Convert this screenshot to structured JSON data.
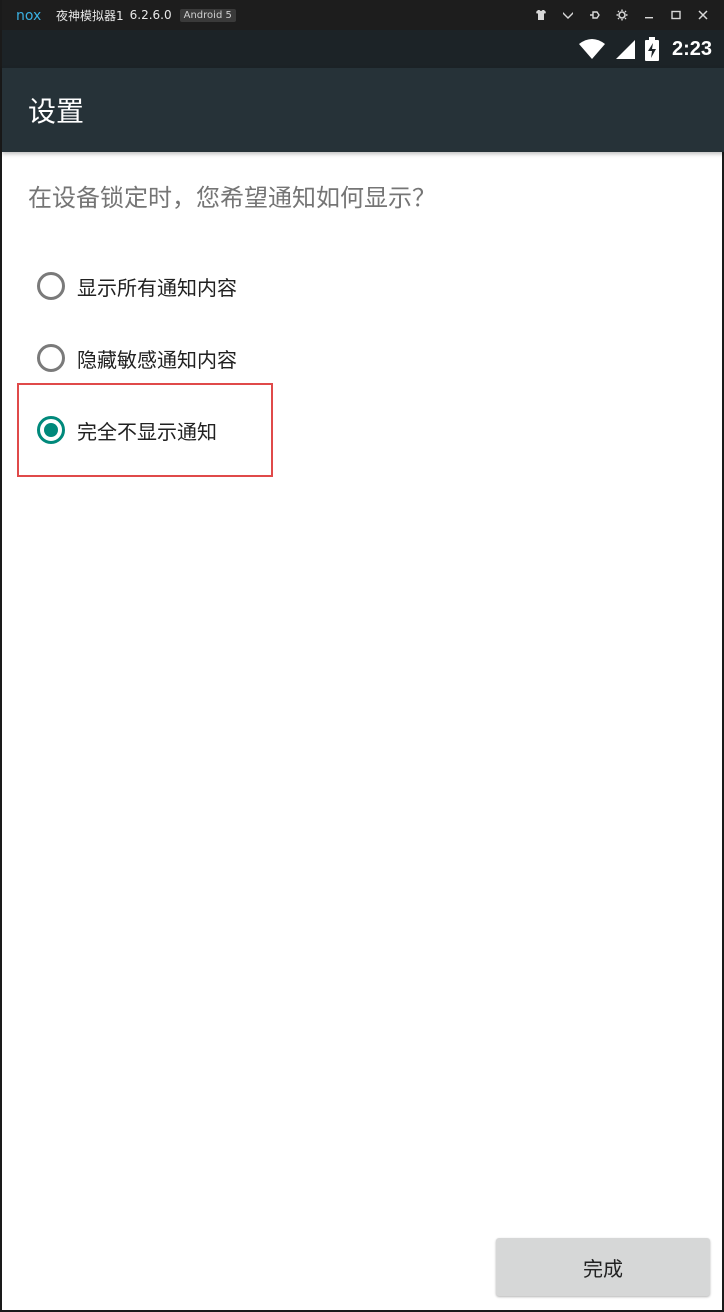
{
  "emulator": {
    "logo": "nox",
    "title": "夜神模拟器1",
    "version": "6.2.6.0",
    "android_badge": "Android 5",
    "controls": [
      "shirt-icon",
      "chevron-down-icon",
      "pin-icon",
      "gear-icon",
      "minimize-icon",
      "maximize-icon",
      "close-icon"
    ]
  },
  "status_bar": {
    "time": "2:23",
    "icons": [
      "wifi-icon",
      "signal-icon",
      "battery-charging-icon"
    ]
  },
  "app_bar": {
    "title": "设置"
  },
  "question": "在设备锁定时，您希望通知如何显示？",
  "options": [
    {
      "label": "显示所有通知内容",
      "checked": false
    },
    {
      "label": "隐藏敏感通知内容",
      "checked": false
    },
    {
      "label": "完全不显示通知",
      "checked": true
    }
  ],
  "done_button": {
    "label": "完成"
  },
  "colors": {
    "app_bar": "#263238",
    "status_bar": "#1c2327",
    "accent": "#00897b",
    "highlight": "#e04a4a"
  }
}
